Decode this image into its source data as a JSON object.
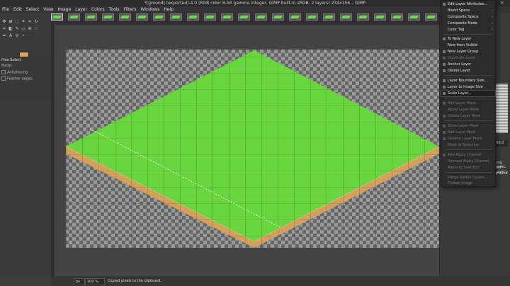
{
  "window": {
    "title": "*[ground] (exported)-4.0 (RGB color 8-bit gamma integer, GIMP built-in sRGB, 2 layers) 234x156 – GIMP"
  },
  "menubar": [
    "File",
    "Edit",
    "Select",
    "View",
    "Image",
    "Layer",
    "Colors",
    "Tools",
    "Filters",
    "Windows",
    "Help"
  ],
  "tool_options": {
    "title": "Free Select",
    "mode_label": "Mode:",
    "antialiasing": "Antialiasing",
    "feather_edges": "Feather edges"
  },
  "colors": {
    "foreground": "#d9a35a",
    "background": "#76c356",
    "ground_top": "#6ad63f",
    "ground_side": "#d6a05a"
  },
  "layer_menu": {
    "items": [
      {
        "label": "Edit Layer Attributes...",
        "disabled": false,
        "submenu": false
      },
      {
        "label": "Blend Space",
        "disabled": false,
        "submenu": true
      },
      {
        "label": "Composite Space",
        "disabled": false,
        "submenu": true
      },
      {
        "label": "Composite Mode",
        "disabled": false,
        "submenu": true
      },
      {
        "label": "Color Tag",
        "disabled": false,
        "submenu": true
      },
      {
        "label": "To New Layer",
        "disabled": false,
        "submenu": false
      },
      {
        "label": "New from Visible",
        "disabled": false,
        "submenu": false
      },
      {
        "label": "New Layer Group",
        "disabled": false,
        "submenu": false
      },
      {
        "label": "Duplicate Layer",
        "disabled": true,
        "submenu": false
      },
      {
        "label": "Anchor Layer",
        "disabled": false,
        "submenu": false
      },
      {
        "label": "Delete Layer",
        "disabled": false,
        "submenu": false
      },
      {
        "label": "Layer Boundary Size...",
        "disabled": false,
        "submenu": false
      },
      {
        "label": "Layer to Image Size",
        "disabled": false,
        "submenu": false
      },
      {
        "label": "Scale Layer...",
        "disabled": false,
        "submenu": false,
        "highlight": true
      },
      {
        "label": "Add Layer Mask...",
        "disabled": true,
        "submenu": false
      },
      {
        "label": "Apply Layer Mask",
        "disabled": true,
        "submenu": false
      },
      {
        "label": "Delete Layer Mask",
        "disabled": true,
        "submenu": false
      },
      {
        "label": "Show Layer Mask",
        "disabled": true,
        "submenu": false
      },
      {
        "label": "Edit Layer Mask",
        "disabled": true,
        "submenu": false
      },
      {
        "label": "Disable Layer Mask",
        "disabled": true,
        "submenu": false
      },
      {
        "label": "Mask to Selection",
        "disabled": true,
        "submenu": false
      },
      {
        "label": "Add Alpha Channel",
        "disabled": true,
        "submenu": false
      },
      {
        "label": "Remove Alpha Channel",
        "disabled": true,
        "submenu": false
      },
      {
        "label": "Alpha to Selection",
        "disabled": true,
        "submenu": false
      },
      {
        "label": "Merge Visible Layers...",
        "disabled": true,
        "submenu": false
      },
      {
        "label": "Flatten Image",
        "disabled": true,
        "submenu": false
      }
    ]
  },
  "right_dock": {
    "visible_text": [
      "100.0",
      "ting (selec",
      "red Layer)",
      "ground"
    ]
  },
  "statusbar": {
    "unit": "px",
    "zoom": "100 %",
    "message": "Copied pixels to the clipboard."
  }
}
